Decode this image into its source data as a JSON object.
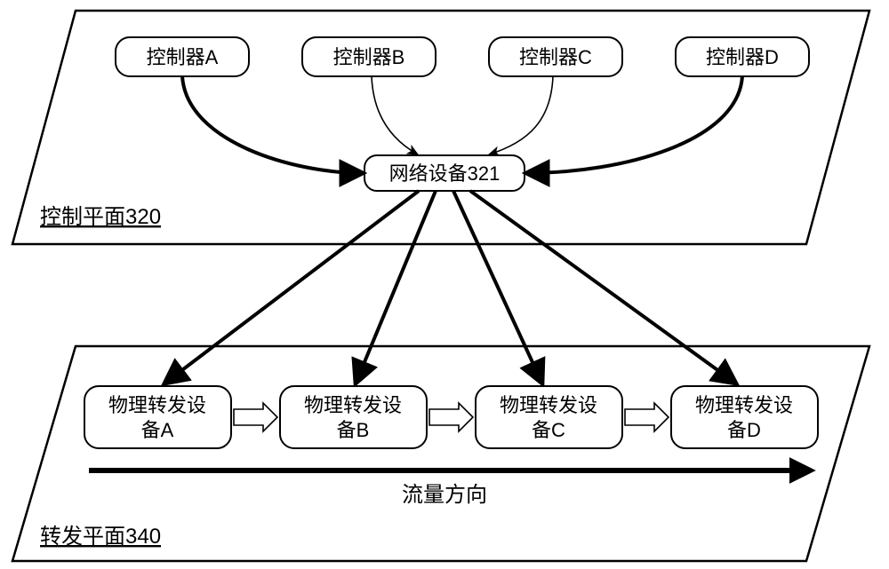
{
  "control_plane": {
    "label": "控制平面320",
    "controllers": [
      "控制器A",
      "控制器B",
      "控制器C",
      "控制器D"
    ],
    "network_device": "网络设备321"
  },
  "forwarding_plane": {
    "label": "转发平面340",
    "devices_prefix": "物理转发设",
    "devices_suffix": [
      "备A",
      "备B",
      "备C",
      "备D"
    ],
    "flow_direction_label": "流量方向"
  }
}
